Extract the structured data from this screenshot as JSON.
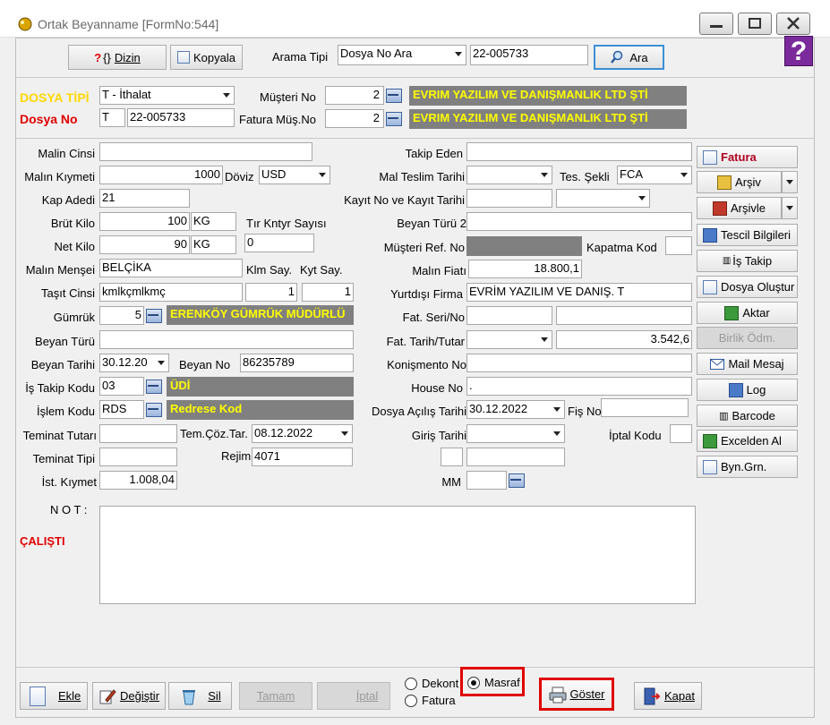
{
  "window": {
    "title": "Ortak Beyanname [FormNo:544]",
    "controls": {
      "minimize": "—",
      "maximize": "☐",
      "close": "✕"
    }
  },
  "toolbar": {
    "dizin": "Dizin",
    "kopyala": "Kopyala",
    "arama_tipi_label": "Arama Tipi",
    "arama_tipi_value": "Dosya No Ara",
    "search_value": "22-005733",
    "ara": "Ara",
    "help": "?"
  },
  "header": {
    "dosya_tipi_label": "DOSYA TİPİ",
    "dosya_tipi_value": "T - İthalat",
    "dosya_no_label": "Dosya No",
    "dosya_no_prefix": "T",
    "dosya_no_value": "22-005733",
    "musteri_no_label": "Müşteri No",
    "musteri_no_value": "2",
    "musteri_name": "EVRIM YAZILIM VE DANIŞMANLIK LTD ŞTİ",
    "fatura_mus_label": "Fatura Müş.No",
    "fatura_mus_value": "2",
    "fatura_mus_name": "EVRIM YAZILIM VE DANIŞMANLIK LTD ŞTİ"
  },
  "left": {
    "malin_cinsi": {
      "label": "Malin Cinsi",
      "value": ""
    },
    "malin_kiymeti": {
      "label": "Malın Kıymeti",
      "value": "1000"
    },
    "doviz": {
      "label": "Döviz",
      "value": "USD"
    },
    "kap_adedi": {
      "label": "Kap Adedi",
      "value": "21"
    },
    "brut_kilo": {
      "label": "Brüt Kilo",
      "value": "100",
      "unit": "KG"
    },
    "tir_label": "Tır Kntyr Sayısı",
    "tir_value": "0",
    "net_kilo": {
      "label": "Net Kilo",
      "value": "90",
      "unit": "KG"
    },
    "mensei": {
      "label": "Malın Menşei",
      "value": "BELÇİKA"
    },
    "klm_say": "Klm Say.",
    "kyt_say": "Kyt Say.",
    "tasit": {
      "label": "Taşıt Cinsi",
      "value": "kmlkçmlkmç",
      "klm": "1",
      "kyt": "1"
    },
    "gumruk": {
      "label": "Gümrük",
      "value": "5",
      "name": "ERENKÖY GÜMRÜK MÜDÜRLÜ"
    },
    "beyan_turu": {
      "label": "Beyan Türü",
      "value": ""
    },
    "beyan_tarihi": {
      "label": "Beyan Tarihi",
      "value": "30.12.20"
    },
    "beyan_no": {
      "label": "Beyan No",
      "value": "86235789"
    },
    "is_takip": {
      "label": "İş Takip Kodu",
      "value": "03",
      "name": "ÜDİ"
    },
    "islem_kodu": {
      "label": "İşlem Kodu",
      "value": "RDS",
      "name": "Redrese Kod"
    },
    "teminat_tutari": {
      "label": "Teminat Tutarı",
      "value": ""
    },
    "tem_coz": {
      "label": "Tem.Çöz.Tar.",
      "value": "08.12.2022"
    },
    "teminat_tipi": {
      "label": "Teminat Tipi",
      "value": ""
    },
    "rejim": {
      "label": "Rejim",
      "value": "4071"
    },
    "ist_kiymet": {
      "label": "İst. Kıymet",
      "value": "1.008,04"
    }
  },
  "right": {
    "takip_eden": {
      "label": "Takip Eden",
      "value": ""
    },
    "mal_teslim": {
      "label": "Mal Teslim Tarihi",
      "value": ""
    },
    "tes_sekli": {
      "label": "Tes. Şekli",
      "value": "FCA"
    },
    "kayit_no": {
      "label": "Kayıt  No  ve Kayıt Tarihi",
      "value": ""
    },
    "beyan_turu2": {
      "label": "Beyan Türü 2",
      "value": ""
    },
    "musteri_ref": {
      "label": "Müşteri  Ref. No",
      "value": ""
    },
    "kapatma_kod": {
      "label": "Kapatma Kod",
      "value": ""
    },
    "malin_fiati": {
      "label": "Malın Fiatı",
      "value": "18.800,1"
    },
    "yurtdisi": {
      "label": "Yurtdışı Firma",
      "value": "EVRİM YAZILIM VE DANIŞ. T"
    },
    "fat_seri": {
      "label": "Fat. Seri/No",
      "value": ""
    },
    "fat_tarih": {
      "label": "Fat. Tarih/Tutar",
      "value": "",
      "tutar": "3.542,6"
    },
    "konismento": {
      "label": "Konişmento No",
      "value": ""
    },
    "house_no": {
      "label": "House No",
      "value": "."
    },
    "dosya_acilis": {
      "label": "Dosya Açılış Tarihi",
      "value": "30.12.2022"
    },
    "fis_no": {
      "label": "Fiş No",
      "value": ""
    },
    "giris_tarihi": {
      "label": "Giriş Tarihi",
      "value": ""
    },
    "iptal_kodu": {
      "label": "İptal Kodu",
      "value": ""
    },
    "mm": {
      "label": "MM",
      "value": ""
    }
  },
  "side_buttons": [
    "Fatura",
    "Arşiv",
    "Arşivle",
    "Tescil Bilgileri",
    "İş Takip",
    "Dosya Oluştur",
    "Aktar",
    "Birlik Ödm.",
    "Mail Mesaj",
    "Log",
    "Barcode",
    "Excelden Al",
    "Byn.Grn."
  ],
  "note": {
    "label": "N O T :",
    "status": "ÇALIŞTI",
    "value": ""
  },
  "bottom": {
    "ekle": "Ekle",
    "degistir": "Değiştir",
    "sil": "Sil",
    "tamam": "Tamam",
    "iptal": "İptal",
    "radio_dekont": "Dekont",
    "radio_fatura": "Fatura",
    "radio_masraf": "Masraf",
    "goster": "Göster",
    "kapat": "Kapat"
  }
}
